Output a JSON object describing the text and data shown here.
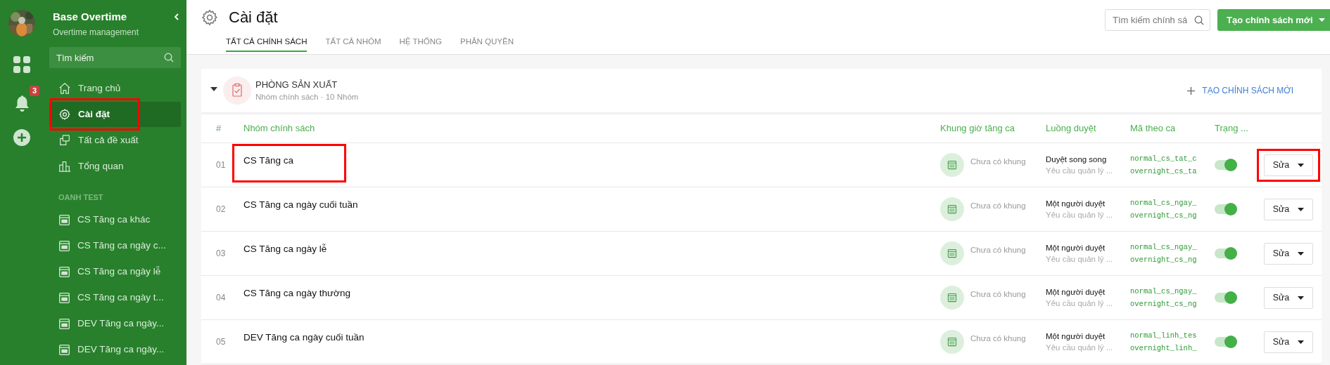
{
  "rail": {
    "notification_count": "3"
  },
  "sidebar": {
    "app_title": "Base Overtime",
    "app_subtitle": "Overtime management",
    "search": {
      "placeholder": "Tìm kiếm"
    },
    "menu": [
      {
        "label": "Trang chủ",
        "selected": false,
        "highlighted": false
      },
      {
        "label": "Cài đặt",
        "selected": true,
        "highlighted": true
      },
      {
        "label": "Tất cả đề xuất",
        "selected": false,
        "highlighted": false
      },
      {
        "label": "Tổng quan",
        "selected": false,
        "highlighted": false
      }
    ],
    "section_label": "OANH TEST",
    "policies": [
      "CS Tăng ca khác",
      "CS Tăng ca ngày c...",
      "CS Tăng ca ngày lễ",
      "CS Tăng ca ngày t...",
      "DEV Tăng ca ngày...",
      "DEV Tăng ca ngày..."
    ]
  },
  "header": {
    "title": "Cài đặt",
    "tabs": [
      {
        "label": "TẤT CẢ CHÍNH SÁCH",
        "selected": true
      },
      {
        "label": "TẤT CẢ NHÓM",
        "selected": false
      },
      {
        "label": "HỆ THỐNG",
        "selected": false
      },
      {
        "label": "PHÂN QUYỀN",
        "selected": false
      }
    ],
    "search": {
      "placeholder": "Tìm kiếm chính sá"
    },
    "create_button": "Tạo chính sách mới"
  },
  "group": {
    "title": "PHÒNG SẢN XUẤT",
    "subtitle": "Nhóm chính sách · 10 Nhóm",
    "expanded": true,
    "add_link": "TẠO CHÍNH SÁCH MỚI"
  },
  "table": {
    "columns": [
      "#",
      "Nhóm chính sách",
      "Khung giờ tăng ca",
      "Luồng duyệt",
      "Mã theo ca",
      "Trạng ..."
    ],
    "rows": [
      {
        "index": "01",
        "name": "CS Tăng ca",
        "name_highlighted": true,
        "shift_window": "Chưa có khung",
        "flow": "Duyệt song song",
        "flow_note": "Yêu cầu quản lý ...",
        "codes": [
          "normal_cs_tat_c",
          "overnight_cs_ta"
        ],
        "on": true,
        "edit": "Sửa",
        "edit_highlighted": true
      },
      {
        "index": "02",
        "name": "CS Tăng ca ngày cuối tuần",
        "name_highlighted": false,
        "shift_window": "Chưa có khung",
        "flow": "Một người duyệt",
        "flow_note": "Yêu cầu quản lý ...",
        "codes": [
          "normal_cs_ngay_",
          "overnight_cs_ng"
        ],
        "on": true,
        "edit": "Sửa",
        "edit_highlighted": false
      },
      {
        "index": "03",
        "name": "CS Tăng ca ngày lễ",
        "name_highlighted": false,
        "shift_window": "Chưa có khung",
        "flow": "Một người duyệt",
        "flow_note": "Yêu cầu quản lý ...",
        "codes": [
          "normal_cs_ngay_",
          "overnight_cs_ng"
        ],
        "on": true,
        "edit": "Sửa",
        "edit_highlighted": false
      },
      {
        "index": "04",
        "name": "CS Tăng ca ngày thường",
        "name_highlighted": false,
        "shift_window": "Chưa có khung",
        "flow": "Một người duyệt",
        "flow_note": "Yêu cầu quản lý ...",
        "codes": [
          "normal_cs_ngay_",
          "overnight_cs_ng"
        ],
        "on": true,
        "edit": "Sửa",
        "edit_highlighted": false
      },
      {
        "index": "05",
        "name": "DEV Tăng ca ngày cuối tuần",
        "name_highlighted": false,
        "shift_window": "Chưa có khung",
        "flow": "Một người duyệt",
        "flow_note": "Yêu cầu quản lý ...",
        "codes": [
          "normal_linh_tes",
          "overnight_linh_"
        ],
        "on": true,
        "edit": "Sửa",
        "edit_highlighted": false
      }
    ]
  }
}
